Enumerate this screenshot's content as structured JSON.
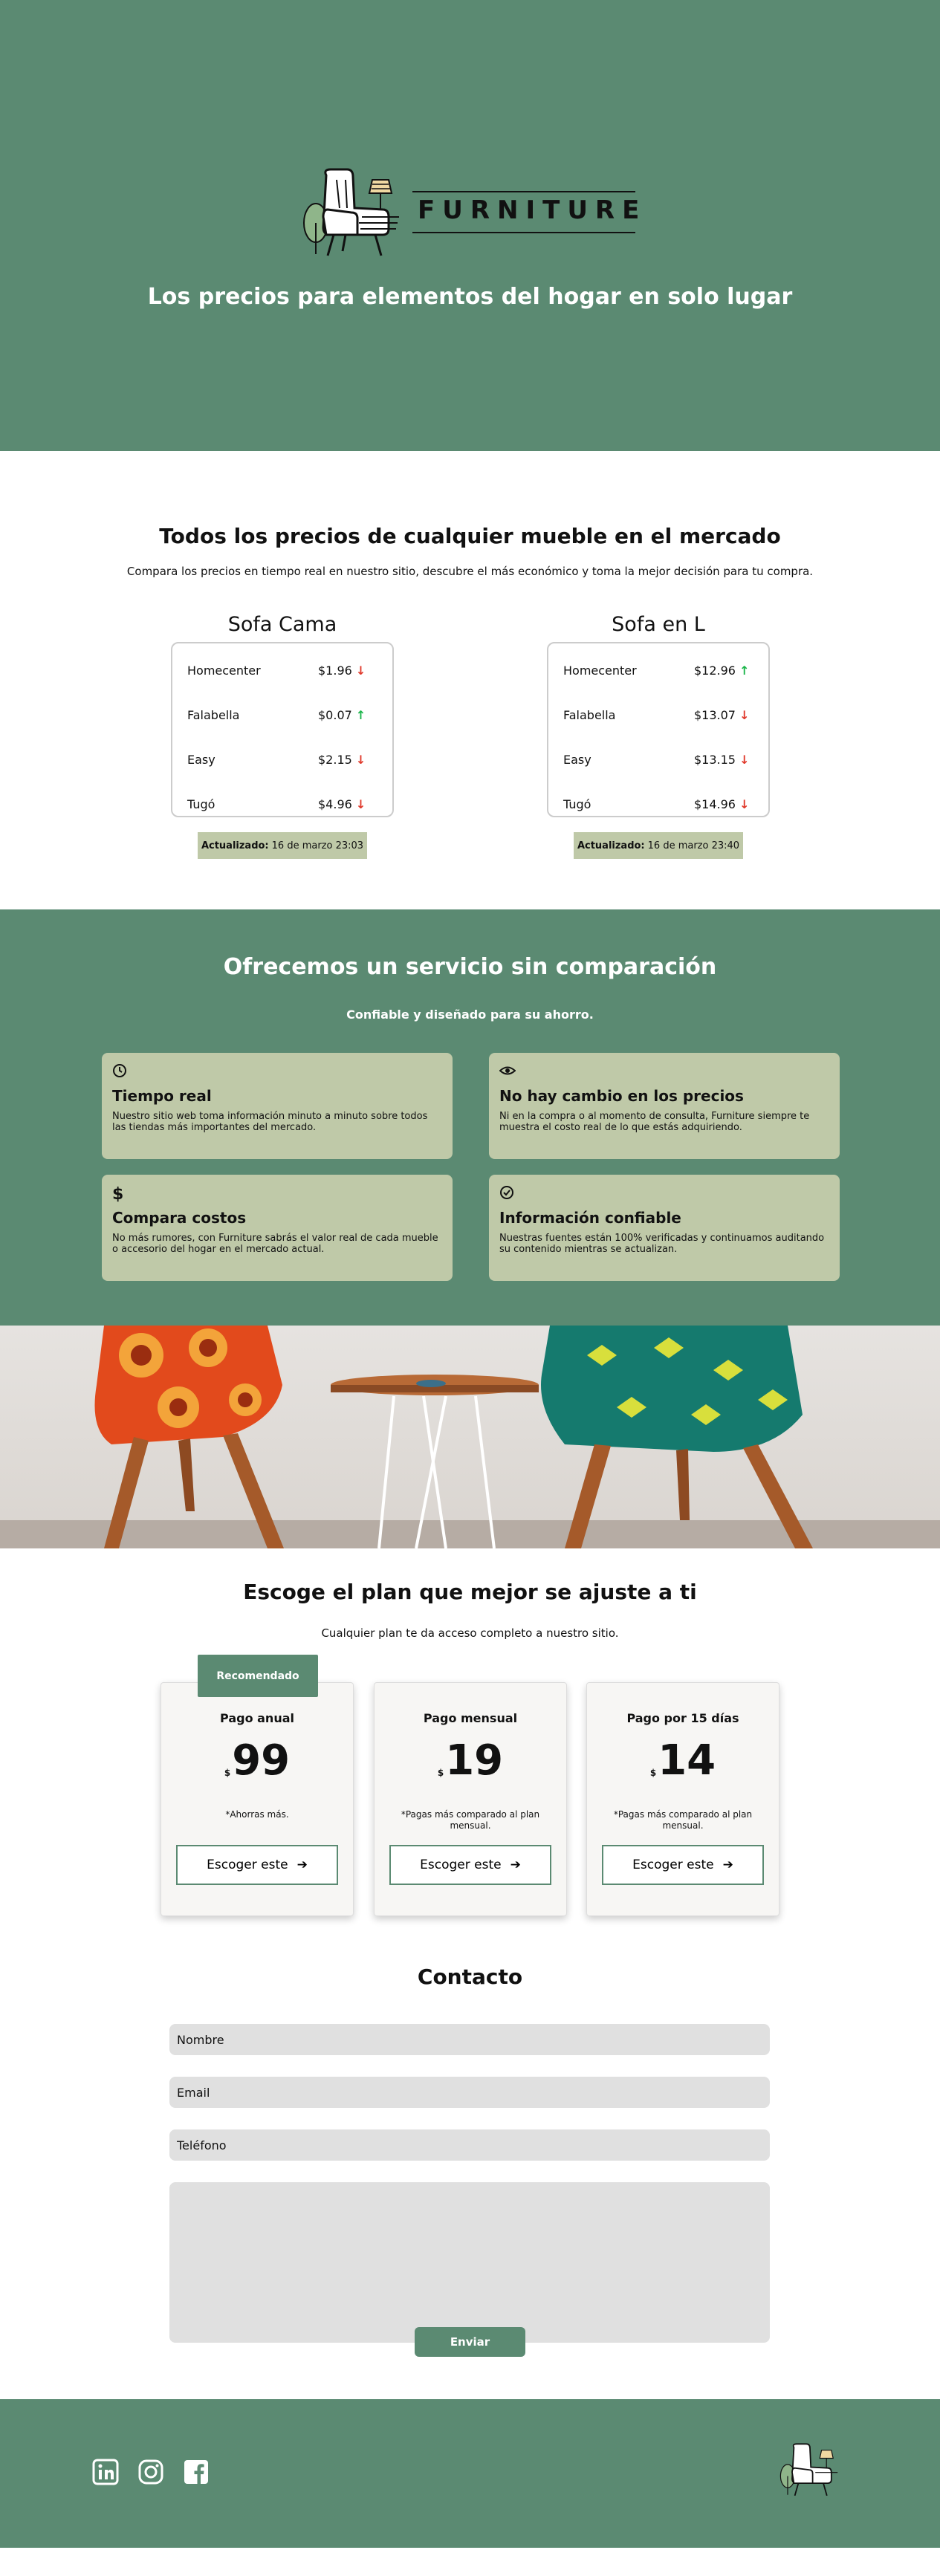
{
  "brand": {
    "name": "FURNITURE"
  },
  "hero": {
    "tagline": "Los precios para elementos del hogar en solo lugar"
  },
  "prices": {
    "title": "Todos los precios de cualquier mueble en el mercado",
    "subtitle": "Compara los precios en tiempo real en nuestro sitio, descubre el más económico y toma la mejor decisión para tu compra.",
    "updated_label": "Actualizado:",
    "products": [
      {
        "name": "Sofa Cama",
        "updated": "16 de marzo 23:03",
        "rows": [
          {
            "store": "Homecenter",
            "price": "$1.96",
            "trend": "down"
          },
          {
            "store": "Falabella",
            "price": "$0.07",
            "trend": "up"
          },
          {
            "store": "Easy",
            "price": "$2.15",
            "trend": "down"
          },
          {
            "store": "Tugó",
            "price": "$4.96",
            "trend": "down"
          }
        ]
      },
      {
        "name": "Sofa en L",
        "updated": "16 de marzo 23:40",
        "rows": [
          {
            "store": "Homecenter",
            "price": "$12.96",
            "trend": "up"
          },
          {
            "store": "Falabella",
            "price": "$13.07",
            "trend": "down"
          },
          {
            "store": "Easy",
            "price": "$13.15",
            "trend": "down"
          },
          {
            "store": "Tugó",
            "price": "$14.96",
            "trend": "down"
          }
        ]
      }
    ]
  },
  "service": {
    "title": "Ofrecemos un servicio sin comparación",
    "subtitle": "Confiable y diseñado para su ahorro.",
    "cards": [
      {
        "icon": "clock-icon",
        "title": "Tiempo real",
        "text": "Nuestro sitio web toma información minuto a minuto sobre todos las tiendas más importantes del mercado."
      },
      {
        "icon": "eye-icon",
        "title": "No hay cambio en los precios",
        "text": "Ni en la compra o al momento de consulta, Furniture siempre te muestra el costo real de lo que estás adquiriendo."
      },
      {
        "icon": "dollar-icon",
        "title": "Compara costos",
        "text": "No más rumores, con Furniture sabrás el valor real de cada mueble o accesorio del hogar en el mercado actual."
      },
      {
        "icon": "check-circle-icon",
        "title": "Información confiable",
        "text": "Nuestras fuentes están 100% verificadas y continuamos auditando su contenido mientras se actualizan."
      }
    ]
  },
  "plans": {
    "title": "Escoge el plan que mejor se ajuste a ti",
    "subtitle": "Cualquier plan te da acceso completo a nuestro sitio.",
    "ribbon": "Recomendado",
    "currency": "$",
    "items": [
      {
        "name": "Pago anual",
        "price": "99",
        "note": "*Ahorras más.",
        "button": "Escoger este"
      },
      {
        "name": "Pago mensual",
        "price": "19",
        "note": "*Pagas más comparado al plan mensual.",
        "button": "Escoger este"
      },
      {
        "name": "Pago por 15 días",
        "price": "14",
        "note": "*Pagas más comparado al plan mensual.",
        "button": "Escoger este"
      }
    ]
  },
  "contact": {
    "title": "Contacto",
    "name_placeholder": "Nombre",
    "email_placeholder": "Email",
    "phone_placeholder": "Teléfono",
    "message_placeholder": "",
    "send_label": "Enviar"
  },
  "footer": {
    "social": [
      "linkedin-icon",
      "instagram-icon",
      "facebook-icon"
    ]
  },
  "colors": {
    "primary": "#5b8a72",
    "card": "#bfc9a8",
    "up": "#1bb54a",
    "down": "#e03a2c"
  }
}
